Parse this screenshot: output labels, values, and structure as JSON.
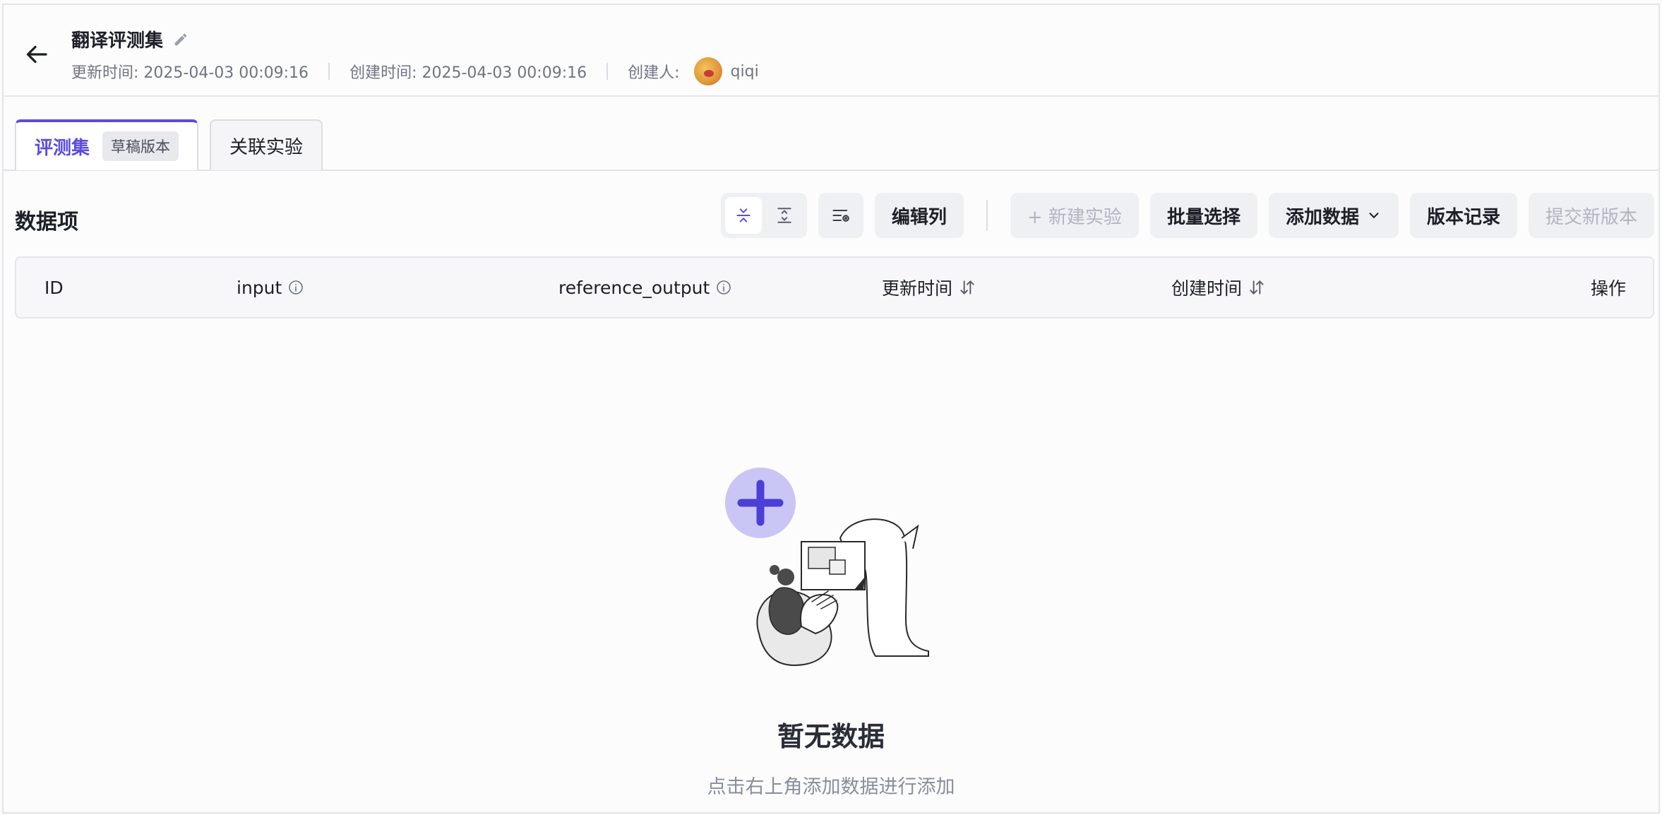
{
  "header": {
    "title": "翻译评测集",
    "updated_label": "更新时间: 2025-04-03 00:09:16",
    "created_label": "创建时间: 2025-04-03 00:09:16",
    "creator_label": "创建人:",
    "creator_name": "qiqi"
  },
  "tabs": [
    {
      "label": "评测集",
      "badge": "草稿版本"
    },
    {
      "label": "关联实验"
    }
  ],
  "section": {
    "title": "数据项"
  },
  "toolbar": {
    "edit_columns": "编辑列",
    "new_experiment": "+ 新建实验",
    "batch_select": "批量选择",
    "add_data": "添加数据",
    "version_history": "版本记录",
    "submit_version": "提交新版本"
  },
  "table": {
    "columns": [
      "ID",
      "input",
      "reference_output",
      "更新时间",
      "创建时间",
      "操作"
    ]
  },
  "empty": {
    "title": "暂无数据",
    "description": "点击右上角添加数据进行添加"
  },
  "colors": {
    "accent": "#5b4ce0",
    "button_bg": "#eff0f4",
    "disabled_text": "#b2b5c0"
  },
  "icons": [
    "arrow-left-icon",
    "pencil-icon",
    "collapse-rows-icon",
    "expand-rows-icon",
    "column-settings-icon",
    "chevron-down-icon",
    "info-icon",
    "sort-icon",
    "plus-icon"
  ]
}
